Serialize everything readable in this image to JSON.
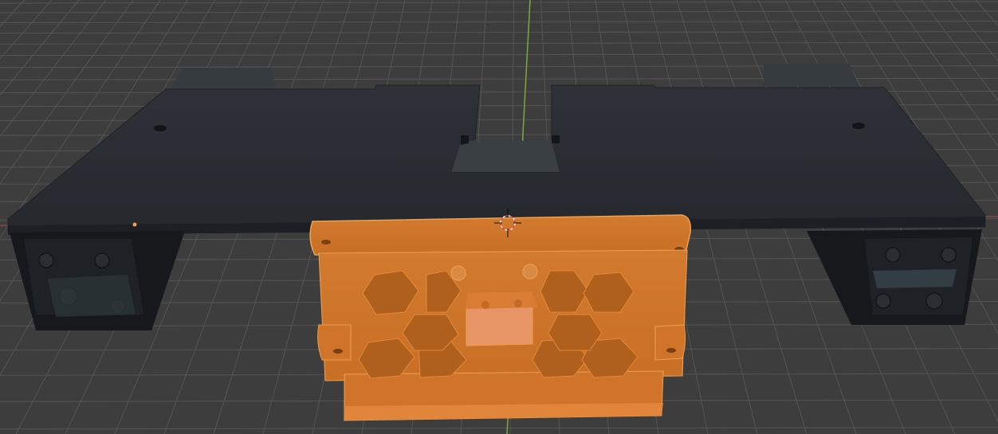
{
  "viewport": {
    "name": "3D Viewport",
    "background": "#3d3d3d",
    "grid_color": "#555555",
    "y_axis_color": "#7fa83a",
    "x_axis_color": "#b34a4a"
  },
  "scene": {
    "base_plate": {
      "color": "#2b2f36",
      "selected": false
    },
    "bracket": {
      "color": "#d8762c",
      "selected": true
    },
    "origin_marker": {
      "color": "#f0a050"
    },
    "cursor_3d": {
      "colors": [
        "#e04040",
        "#ffffff"
      ]
    }
  }
}
